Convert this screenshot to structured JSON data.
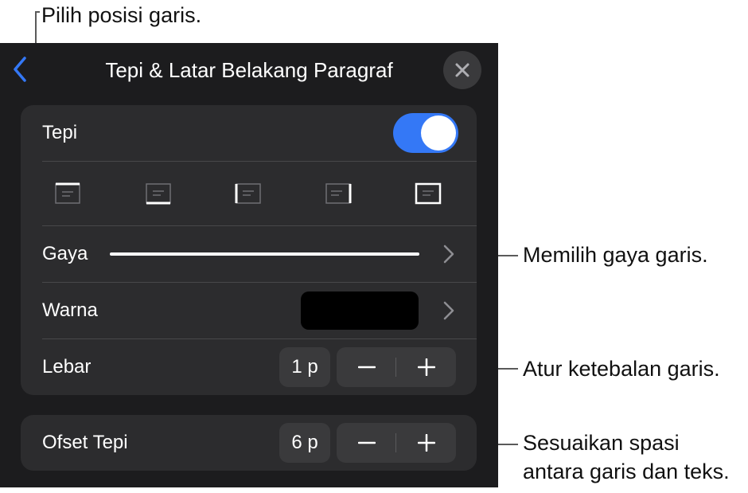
{
  "callouts": {
    "position": "Pilih posisi garis.",
    "style": "Memilih gaya garis.",
    "width": "Atur ketebalan garis.",
    "offset_line1": "Sesuaikan spasi",
    "offset_line2": "antara garis dan teks."
  },
  "panel": {
    "title": "Tepi & Latar Belakang Paragraf",
    "icons": {
      "back": "chevron-left-icon",
      "close": "close-icon"
    }
  },
  "borders": {
    "label": "Tepi",
    "enabled": true,
    "positions": [
      "top-border",
      "bottom-border",
      "left-border",
      "right-border",
      "all-borders"
    ]
  },
  "style": {
    "label": "Gaya"
  },
  "color": {
    "label": "Warna",
    "value": "#000000"
  },
  "width": {
    "label": "Lebar",
    "value": "1 p",
    "decrement": "−",
    "increment": "+"
  },
  "offset": {
    "label": "Ofset Tepi",
    "value": "6 p",
    "decrement": "−",
    "increment": "+"
  },
  "colors": {
    "accent": "#3478f6",
    "panel": "#1c1c1e",
    "group": "#2c2c2e",
    "control": "#3a3a3c"
  }
}
